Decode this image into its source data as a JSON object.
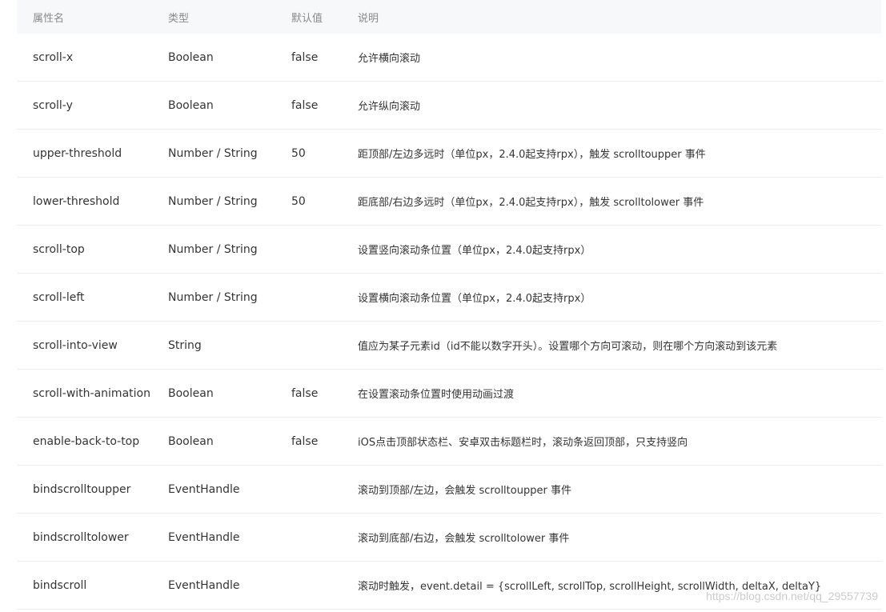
{
  "header": {
    "name": "属性名",
    "type": "类型",
    "default": "默认值",
    "desc": "说明"
  },
  "rows": [
    {
      "name": "scroll-x",
      "type": "Boolean",
      "default": "false",
      "desc": "允许横向滚动"
    },
    {
      "name": "scroll-y",
      "type": "Boolean",
      "default": "false",
      "desc": "允许纵向滚动"
    },
    {
      "name": "upper-threshold",
      "type": "Number / String",
      "default": "50",
      "desc": "距顶部/左边多远时（单位px，2.4.0起支持rpx），触发 scrolltoupper 事件"
    },
    {
      "name": "lower-threshold",
      "type": "Number / String",
      "default": "50",
      "desc": "距底部/右边多远时（单位px，2.4.0起支持rpx），触发 scrolltolower 事件"
    },
    {
      "name": "scroll-top",
      "type": "Number / String",
      "default": "",
      "desc": "设置竖向滚动条位置（单位px，2.4.0起支持rpx）"
    },
    {
      "name": "scroll-left",
      "type": "Number / String",
      "default": "",
      "desc": "设置横向滚动条位置（单位px，2.4.0起支持rpx）"
    },
    {
      "name": "scroll-into-view",
      "type": "String",
      "default": "",
      "desc": "值应为某子元素id（id不能以数字开头）。设置哪个方向可滚动，则在哪个方向滚动到该元素"
    },
    {
      "name": "scroll-with-animation",
      "type": "Boolean",
      "default": "false",
      "desc": "在设置滚动条位置时使用动画过渡"
    },
    {
      "name": "enable-back-to-top",
      "type": "Boolean",
      "default": "false",
      "desc": "iOS点击顶部状态栏、安卓双击标题栏时，滚动条返回顶部，只支持竖向"
    },
    {
      "name": "bindscrolltoupper",
      "type": "EventHandle",
      "default": "",
      "desc": "滚动到顶部/左边，会触发 scrolltoupper 事件"
    },
    {
      "name": "bindscrolltolower",
      "type": "EventHandle",
      "default": "",
      "desc": "滚动到底部/右边，会触发 scrolltolower 事件"
    },
    {
      "name": "bindscroll",
      "type": "EventHandle",
      "default": "",
      "desc": "滚动时触发，event.detail = {scrollLeft, scrollTop, scrollHeight, scrollWidth, deltaX, deltaY}"
    }
  ],
  "watermark": "https://blog.csdn.net/qq_29557739"
}
